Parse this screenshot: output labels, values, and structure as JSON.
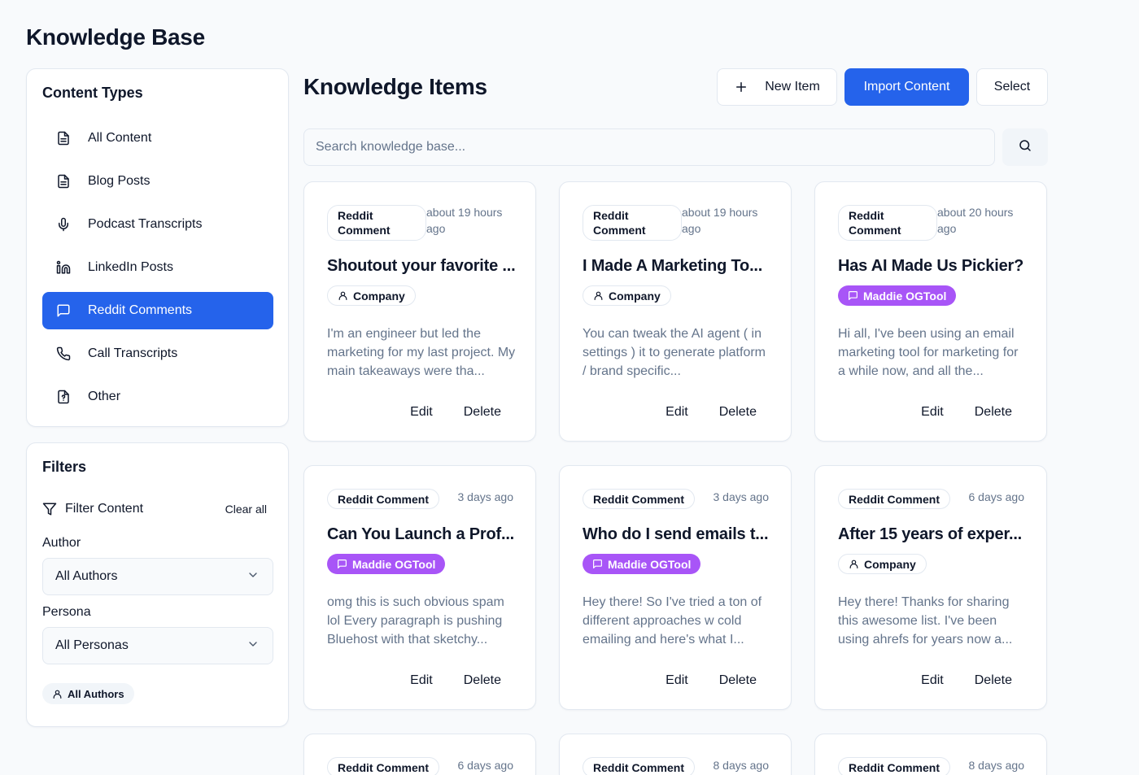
{
  "page": {
    "title": "Knowledge Base"
  },
  "sidebar": {
    "heading": "Content Types",
    "items": [
      {
        "label": "All Content",
        "icon": "file-text-icon"
      },
      {
        "label": "Blog Posts",
        "icon": "file-text-icon"
      },
      {
        "label": "Podcast Transcripts",
        "icon": "microphone-icon"
      },
      {
        "label": "LinkedIn Posts",
        "icon": "linkedin-icon"
      },
      {
        "label": "Reddit Comments",
        "icon": "message-square-icon",
        "active": true
      },
      {
        "label": "Call Transcripts",
        "icon": "phone-icon"
      },
      {
        "label": "Other",
        "icon": "file-question-icon"
      }
    ]
  },
  "filters": {
    "heading": "Filters",
    "filter_label": "Filter Content",
    "clear_all": "Clear all",
    "author_label": "Author",
    "author_value": "All Authors",
    "persona_label": "Persona",
    "persona_value": "All Personas",
    "active_chip": "All Authors"
  },
  "main": {
    "title": "Knowledge Items",
    "new_item": "New Item",
    "import_content": "Import Content",
    "select": "Select",
    "search_placeholder": "Search knowledge base..."
  },
  "card_actions": {
    "edit": "Edit",
    "delete": "Delete"
  },
  "cards": [
    {
      "type": "Reddit Comment",
      "time": "about 19 hours ago",
      "title": "Shoutout your favorite ...",
      "persona": "Company",
      "persona_kind": "company",
      "excerpt": "I'm an engineer but led the marketing for my last project. My main takeaways were tha..."
    },
    {
      "type": "Reddit Comment",
      "time": "about 19 hours ago",
      "title": "I Made A Marketing To...",
      "persona": "Company",
      "persona_kind": "company",
      "excerpt": "You can tweak the AI agent ( in settings ) it to generate platform / brand specific..."
    },
    {
      "type": "Reddit Comment",
      "time": "about 20 hours ago",
      "title": "Has AI Made Us Pickier?",
      "persona": "Maddie OGTool",
      "persona_kind": "maddie",
      "excerpt": "Hi all, I've been using an email marketing tool for marketing for a while now, and all the..."
    },
    {
      "type": "Reddit Comment",
      "time": "3 days ago",
      "title": "Can You Launch a Prof...",
      "persona": "Maddie OGTool",
      "persona_kind": "maddie",
      "excerpt": "omg this is such obvious spam lol Every paragraph is pushing Bluehost with that sketchy..."
    },
    {
      "type": "Reddit Comment",
      "time": "3 days ago",
      "title": "Who do I send emails t...",
      "persona": "Maddie OGTool",
      "persona_kind": "maddie",
      "excerpt": "Hey there! So I've tried a ton of different approaches w cold emailing and here's what I..."
    },
    {
      "type": "Reddit Comment",
      "time": "6 days ago",
      "title": "After 15 years of exper...",
      "persona": "Company",
      "persona_kind": "company",
      "excerpt": "Hey there! Thanks for sharing this awesome list. I've been using ahrefs for years now a..."
    },
    {
      "type": "Reddit Comment",
      "time": "6 days ago"
    },
    {
      "type": "Reddit Comment",
      "time": "8 days ago"
    },
    {
      "type": "Reddit Comment",
      "time": "8 days ago"
    }
  ],
  "colors": {
    "accent": "#2563eb",
    "persona_maddie": "#a855f7",
    "muted_text": "#64748b",
    "border": "#e2e8f0"
  }
}
